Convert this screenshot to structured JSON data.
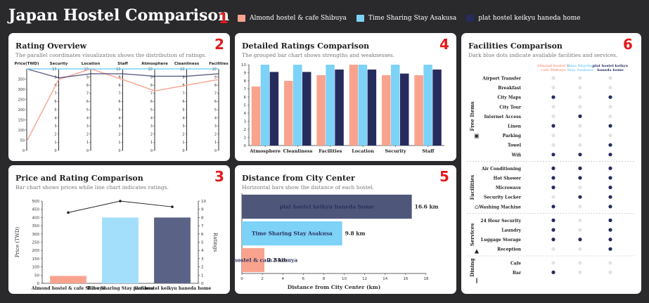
{
  "header": {
    "title": "Japan Hostel Comparison"
  },
  "legend": [
    {
      "label": "Almond hostel & cafe Shibuya",
      "color": "#f9a38e"
    },
    {
      "label": "Time Sharing Stay Asakusa",
      "color": "#7dd2f7"
    },
    {
      "label": "plat hostel keikyu haneda home",
      "color": "#262b5e"
    }
  ],
  "markers": [
    "1",
    "2",
    "3",
    "4",
    "5",
    "6"
  ],
  "panels": {
    "rating": {
      "title": "Rating Overview",
      "subtitle": "The parallel coordinates visualization shows the distribution of ratings."
    },
    "price": {
      "title": "Price and Rating Comparison",
      "subtitle": "Bar chart shows prices while line chart indicates ratings."
    },
    "detailed": {
      "title": "Detailed Ratings Comparison",
      "subtitle": "The grouped bar chart shows strengths and weaknesses."
    },
    "distance": {
      "title": "Distance from City Center",
      "subtitle": "Horizontal bars show the distance of each hostel."
    },
    "facilities": {
      "title": "Facilities Comparison",
      "subtitle": "Dark blue dots indicate available facilities and services."
    }
  },
  "chart_data": [
    {
      "type": "parallel",
      "title": "Rating Overview",
      "axes": [
        "Price(TWD)",
        "Security",
        "Location",
        "Staff",
        "Atmosphere",
        "Cleanliness",
        "Facilities"
      ],
      "ranges": [
        [
          0,
          400
        ],
        [
          0,
          10
        ],
        [
          0,
          10
        ],
        [
          0,
          10
        ],
        [
          0,
          10
        ],
        [
          0,
          10
        ],
        [
          0,
          10
        ]
      ],
      "ticks": [
        [
          0,
          50,
          100,
          150,
          200,
          250,
          300,
          350
        ],
        [
          0,
          1,
          2,
          3,
          4,
          5,
          6,
          7,
          8,
          9,
          10
        ],
        [
          0,
          1,
          2,
          3,
          4,
          5,
          6,
          7,
          8,
          9,
          10
        ],
        [
          0,
          1,
          2,
          3,
          4,
          5,
          6,
          7,
          8,
          9,
          10
        ],
        [
          0,
          1,
          2,
          3,
          4,
          5,
          6,
          7,
          8,
          9,
          10
        ],
        [
          0,
          1,
          2,
          3,
          4,
          5,
          6,
          7,
          8,
          9,
          10
        ],
        [
          0,
          1,
          2,
          3,
          4,
          5,
          6,
          7,
          8,
          9,
          10
        ]
      ],
      "series": [
        {
          "name": "Almond hostel & cafe Shibuya",
          "values": [
            45,
            8.7,
            10,
            8.7,
            7.3,
            8,
            8.7
          ]
        },
        {
          "name": "Time Sharing Stay Asakusa",
          "values": [
            400,
            10,
            10,
            10,
            10,
            10,
            10
          ]
        },
        {
          "name": "plat hostel keikyu haneda home",
          "values": [
            400,
            8.9,
            9.4,
            9.4,
            9.1,
            9.1,
            9.4
          ]
        }
      ]
    },
    {
      "type": "bar+line",
      "title": "Price and Rating Comparison",
      "categories": [
        "Almond hostel & cafe Shibuya",
        "Time Sharing Stay Asakusa",
        "plat hostel keikyu haneda home"
      ],
      "ylabel": "Price (TWD)",
      "ylim": [
        0,
        500
      ],
      "yticks": [
        0,
        50,
        100,
        150,
        200,
        250,
        300,
        350,
        400,
        450,
        500
      ],
      "y2label": "Ratings",
      "y2lim": [
        0,
        10
      ],
      "y2ticks": [
        0,
        1,
        2,
        3,
        4,
        5,
        6,
        7,
        8,
        9,
        10
      ],
      "prices": [
        45,
        400,
        400
      ],
      "ratings": [
        8.6,
        10,
        9.3
      ]
    },
    {
      "type": "bar",
      "title": "Detailed Ratings Comparison",
      "categories": [
        "Atmosphere",
        "Cleanliness",
        "Facilities",
        "Location",
        "Security",
        "Staff"
      ],
      "ylim": [
        0,
        10
      ],
      "yticks": [
        0,
        1,
        2,
        3,
        4,
        5,
        6,
        7,
        8,
        9,
        10
      ],
      "series": [
        {
          "name": "Almond hostel & cafe Shibuya",
          "values": [
            7.3,
            8,
            8.7,
            10,
            8.7,
            8.7
          ]
        },
        {
          "name": "Time Sharing Stay Asakusa",
          "values": [
            10,
            10,
            10,
            10,
            10,
            10
          ]
        },
        {
          "name": "plat hostel keikyu haneda home",
          "values": [
            9.1,
            9.1,
            9.4,
            9.4,
            8.9,
            9.4
          ]
        }
      ]
    },
    {
      "type": "hbar",
      "title": "Distance from City Center",
      "categories": [
        "plat hostel keikyu haneda home",
        "Time Sharing Stay Asakusa",
        "Almond hostel & cafe Shibuya"
      ],
      "values": [
        16.6,
        9.8,
        2.2
      ],
      "value_labels": [
        "16.6 km",
        "9.8 km",
        "2.2 km"
      ],
      "xlabel": "Distance from City Center (km)",
      "xlim": [
        0,
        18
      ],
      "xticks": [
        0,
        2,
        4,
        6,
        8,
        10,
        12,
        14,
        16,
        18
      ]
    },
    {
      "type": "table",
      "title": "Facilities Comparison",
      "columns": [
        "Almond hostel & cafe Shibuya",
        "Time Sharing Stay Asakusa",
        "plat hostel keikyu haneda home"
      ],
      "groups": [
        {
          "name": "Free Items",
          "icon": "gift-icon",
          "rows": [
            {
              "label": "Airport Transfer",
              "values": [
                0,
                0,
                0
              ]
            },
            {
              "label": "Breakfast",
              "values": [
                0,
                0,
                0
              ]
            },
            {
              "label": "City Maps",
              "values": [
                1,
                0,
                1
              ]
            },
            {
              "label": "City Tour",
              "values": [
                0,
                0,
                0
              ]
            },
            {
              "label": "Internet Access",
              "values": [
                0,
                1,
                0
              ]
            },
            {
              "label": "Linen",
              "values": [
                1,
                0,
                1
              ]
            },
            {
              "label": "Parking",
              "values": [
                0,
                0,
                0
              ]
            },
            {
              "label": "Towel",
              "values": [
                0,
                0,
                1
              ]
            },
            {
              "label": "Wifi",
              "values": [
                1,
                1,
                1
              ]
            }
          ]
        },
        {
          "name": "Facilities",
          "icon": "building-icon",
          "rows": [
            {
              "label": "Air Conditioning",
              "values": [
                1,
                1,
                1
              ]
            },
            {
              "label": "Hot Shower",
              "values": [
                1,
                1,
                1
              ]
            },
            {
              "label": "Microwave",
              "values": [
                1,
                0,
                1
              ]
            },
            {
              "label": "Security Locker",
              "values": [
                0,
                1,
                1
              ]
            },
            {
              "label": "Washing Machine",
              "values": [
                1,
                0,
                1
              ]
            }
          ]
        },
        {
          "name": "Services",
          "icon": "bell-icon",
          "rows": [
            {
              "label": "24 Hour Security",
              "values": [
                1,
                0,
                1
              ]
            },
            {
              "label": "Laundry",
              "values": [
                1,
                0,
                1
              ]
            },
            {
              "label": "Luggage Storage",
              "values": [
                1,
                1,
                1
              ]
            },
            {
              "label": "Reception",
              "values": [
                0,
                0,
                1
              ]
            }
          ]
        },
        {
          "name": "Dining",
          "icon": "utensils-icon",
          "rows": [
            {
              "label": "Cafe",
              "values": [
                0,
                0,
                0
              ]
            },
            {
              "label": "Bar",
              "values": [
                1,
                0,
                0
              ]
            }
          ]
        }
      ]
    }
  ]
}
